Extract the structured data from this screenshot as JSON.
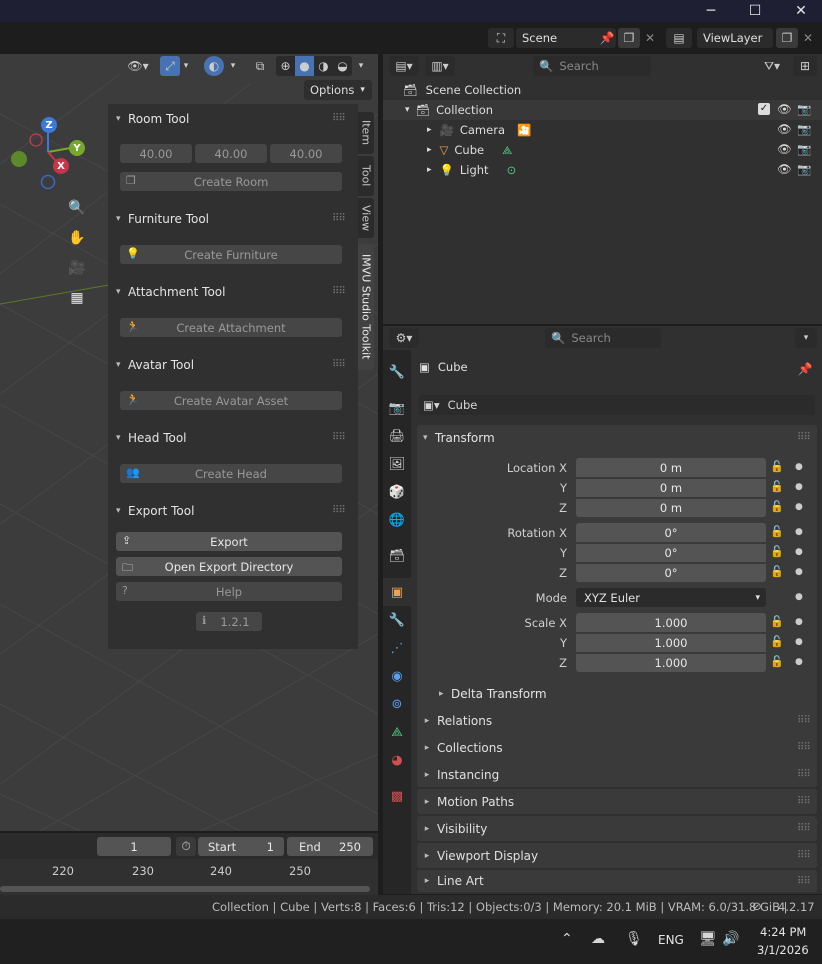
{
  "window": {
    "minimize": "─",
    "maximize": "☐",
    "close": "✕"
  },
  "topbar": {
    "scene": "Scene",
    "view_layer": "ViewLayer"
  },
  "viewport_header": {
    "options_label": "Options"
  },
  "gizmo": {
    "z": "Z",
    "y": "Y",
    "x": "X"
  },
  "sidebar_tabs": [
    "Item",
    "Tool",
    "View",
    "IMVU Studio Toolkit"
  ],
  "room_tool": {
    "title": "Room Tool",
    "values": [
      "40.00",
      "40.00",
      "40.00"
    ],
    "create_label": "Create Room"
  },
  "furniture_tool": {
    "title": "Furniture Tool",
    "create_label": "Create Furniture"
  },
  "attachment_tool": {
    "title": "Attachment Tool",
    "create_label": "Create Attachment"
  },
  "avatar_tool": {
    "title": "Avatar Tool",
    "create_label": "Create Avatar Asset"
  },
  "head_tool": {
    "title": "Head Tool",
    "create_label": "Create Head"
  },
  "export_tool": {
    "title": "Export Tool",
    "export_label": "Export",
    "open_dir_label": "Open Export Directory",
    "help_label": "Help",
    "version": "1.2.1"
  },
  "outliner": {
    "search_placeholder": "Search",
    "scene_collection": "Scene Collection",
    "collection": "Collection",
    "items": [
      "Camera",
      "Cube",
      "Light"
    ]
  },
  "timeline": {
    "current_frame": "1",
    "start_label": "Start",
    "start_value": "1",
    "end_label": "End",
    "end_value": "250",
    "ticks": [
      "220",
      "230",
      "240",
      "250"
    ]
  },
  "properties": {
    "search_placeholder": "Search",
    "object_name": "Cube",
    "data_name": "Cube",
    "transform_title": "Transform",
    "location_label": "Location X",
    "y_label": "Y",
    "z_label": "Z",
    "location": [
      "0 m",
      "0 m",
      "0 m"
    ],
    "rotation_label": "Rotation X",
    "rotation": [
      "0°",
      "0°",
      "0°"
    ],
    "mode_label": "Mode",
    "mode_value": "XYZ Euler",
    "scale_label": "Scale X",
    "scale": [
      "1.000",
      "1.000",
      "1.000"
    ],
    "delta_transform": "Delta Transform",
    "panels": [
      "Relations",
      "Collections",
      "Instancing",
      "Motion Paths",
      "Visibility",
      "Viewport Display",
      "Line Art"
    ]
  },
  "statusbar": {
    "text": "Collection | Cube | Verts:8 | Faces:6 | Tris:12 | Objects:0/3 | Memory: 20.1 MiB | VRAM: 6.0/31.8 GiB |",
    "version": "4.2.17"
  },
  "taskbar": {
    "language": "ENG",
    "time": "4:24 PM",
    "date": "3/1/2026"
  },
  "colors": {
    "accent": "#4772b3",
    "active_orange": "#f0a050",
    "x_axis": "#c8354a",
    "y_axis": "#76a82c",
    "z_axis": "#3b7ad8"
  }
}
